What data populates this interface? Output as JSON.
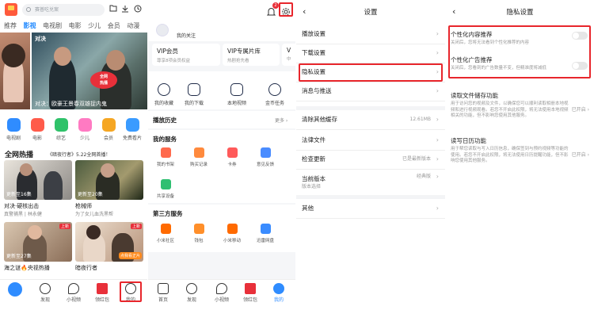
{
  "screen1": {
    "search": {
      "placeholder": "赛普吃兑案"
    },
    "tabs": [
      "推荐",
      "影视",
      "电视剧",
      "电影",
      "少儿",
      "会员",
      "动漫"
    ],
    "active_tab": "影视",
    "banner": {
      "title": "对决",
      "caption": "对决：欧豪王景春双雄捉内鬼",
      "badge_line1": "全网",
      "badge_line2": "热播"
    },
    "categories": [
      {
        "label": "电视剧",
        "color": "#2f8cff"
      },
      {
        "label": "电影",
        "color": "#ff5b4a"
      },
      {
        "label": "综艺",
        "color": "#2fc26a"
      },
      {
        "label": "少儿",
        "color": "#ff7ac2"
      },
      {
        "label": "会员",
        "color": "#f5a623"
      },
      {
        "label": "免费看片",
        "color": "#3a9bff"
      }
    ],
    "hot": {
      "title": "全网热播",
      "subtitle": "《暗夜行者》5.22全网首播！",
      "cards": [
        {
          "ep": "更新至16集",
          "title": "对决·硬核出击",
          "sub": "真警捕黑 | 林永健"
        },
        {
          "ep": "更新至20集",
          "title": "枪械师",
          "sub": "为了女儿血洗黑帮"
        },
        {
          "ep": "更新至27集",
          "title": "海之谜🔥央视热播",
          "sub": "",
          "tag": "上新"
        },
        {
          "ep": "",
          "title": "暗夜行者",
          "sub": "",
          "tag": "上新",
          "play_tag": "点我看正片"
        }
      ]
    },
    "nav": [
      "首页",
      "发现",
      "小视频",
      "领红包",
      "我的"
    ]
  },
  "screen2": {
    "badge_count": "2",
    "profile_link": "我的关注",
    "vip": [
      {
        "title": "VIP会员",
        "sub": "尊享8项会员权益"
      },
      {
        "title": "VIP专属片库",
        "sub": "热剧抢先看"
      },
      {
        "title": "V",
        "sub": "中"
      }
    ],
    "quick": [
      "我的收藏",
      "我的下载",
      "本地视频",
      "金币任务"
    ],
    "history": {
      "title": "播放历史",
      "more": "更多 ›"
    },
    "services": {
      "title": "我的服务",
      "items": [
        {
          "label": "我的书架",
          "color": "#ff6a4d"
        },
        {
          "label": "购买记录",
          "color": "#ff8a3d"
        },
        {
          "label": "卡券",
          "color": "#ff5a5a"
        },
        {
          "label": "意见反馈",
          "color": "#4a8cff"
        },
        {
          "label": "共享设备",
          "color": "#2fbf71"
        }
      ]
    },
    "third": {
      "title": "第三方服务",
      "items": [
        {
          "label": "小米社区",
          "color": "#ff6a00"
        },
        {
          "label": "钱包",
          "color": "#ff8f2a"
        },
        {
          "label": "小米移动",
          "color": "#ff6a00"
        },
        {
          "label": "迅雷网盘",
          "color": "#3a8cff"
        }
      ]
    },
    "nav": [
      "首页",
      "发现",
      "小视频",
      "领红包",
      "我的"
    ]
  },
  "screen3": {
    "title": "设置",
    "rows": [
      {
        "label": "播放设置",
        "value": ""
      },
      {
        "label": "下载设置",
        "value": ""
      },
      {
        "label": "隐私设置",
        "value": ""
      },
      {
        "label": "消息与推送",
        "value": ""
      },
      {
        "label": "清除其他缓存",
        "value": "12.61MB"
      },
      {
        "label": "法律文件",
        "value": ""
      },
      {
        "label": "检查更新",
        "value": "已是最新版本"
      },
      {
        "label": "当前版本",
        "sub": "版本选择",
        "value": "经典版"
      },
      {
        "label": "其他",
        "value": ""
      }
    ]
  },
  "screen4": {
    "title": "隐私设置",
    "items": [
      {
        "title": "个性化内容推荐",
        "desc": "关闭后，您将无法看到个性化推荐的内容"
      },
      {
        "title": "个性化广告推荐",
        "desc": "关闭后，您看到的广告数量不变，但精准度将减低"
      },
      {
        "title": "读取文件储存功能",
        "desc": "用于访问您的视频及文件，以确保您可以顺利读取相册本地视频和进行视频观看。若您不开启此权限，将无法使用本地视频相关的功能，但不影响您使用其他服务。",
        "action": "已开启 ›"
      },
      {
        "title": "读写日历功能",
        "desc": "用于帮您读取与写入日历信息，确保签到与预约视频等功能的使用。若您不开启此权限，将无法使用日历提醒功能，但不影响您使用其他服务。",
        "action": "已开启 ›"
      }
    ]
  },
  "colors": {
    "accent": "#1e88ff",
    "highlight": "#e8262c",
    "nav_dark": "#1f2b48"
  }
}
